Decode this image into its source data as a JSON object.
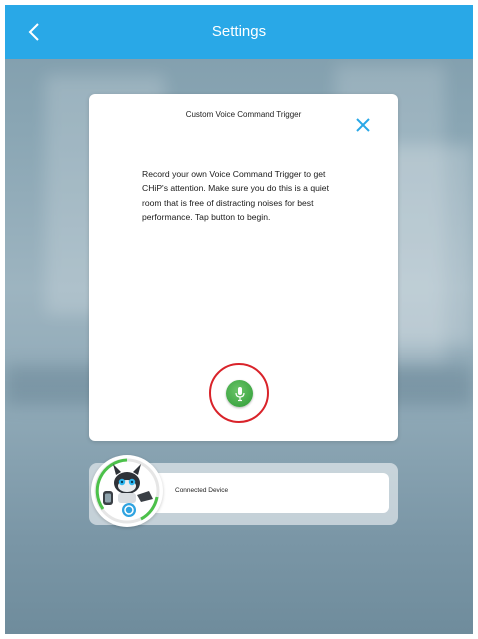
{
  "header": {
    "title": "Settings",
    "back_icon": "chevron-left-icon",
    "color": "#29a8e7"
  },
  "dialog": {
    "title": "Custom Voice Command Trigger",
    "close_icon": "close-icon",
    "body": "Record your own Voice Command Trigger to get CHiP's attention. Make sure you do this is a quiet room that is free of distracting noises for best performance. Tap button to begin.",
    "record_button_icon": "microphone-icon",
    "record_color": "#3fa744",
    "highlight_color": "#d9232a"
  },
  "device": {
    "label": "Connected Device",
    "avatar_icon": "robot-dog-avatar-icon"
  }
}
